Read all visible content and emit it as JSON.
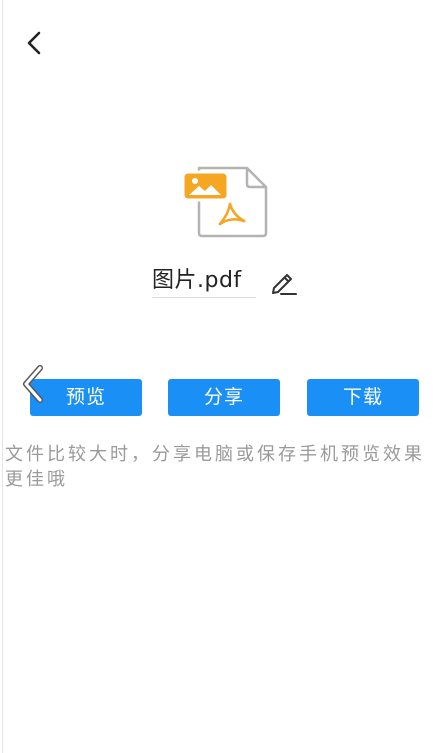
{
  "header": {
    "back_icon": "chevron-left-icon"
  },
  "file": {
    "icon": "pdf-image-file-icon",
    "name": "图片.pdf",
    "edit_icon": "pencil-icon"
  },
  "actions": [
    {
      "label": "预览"
    },
    {
      "label": "分享"
    },
    {
      "label": "下载"
    }
  ],
  "hint": "文件比较大时，分享电脑或保存手机预览效果更佳哦",
  "colors": {
    "primary": "#1A8FF5",
    "accent": "#F5A623",
    "text": "#222222",
    "hint": "#9A9A9A"
  }
}
